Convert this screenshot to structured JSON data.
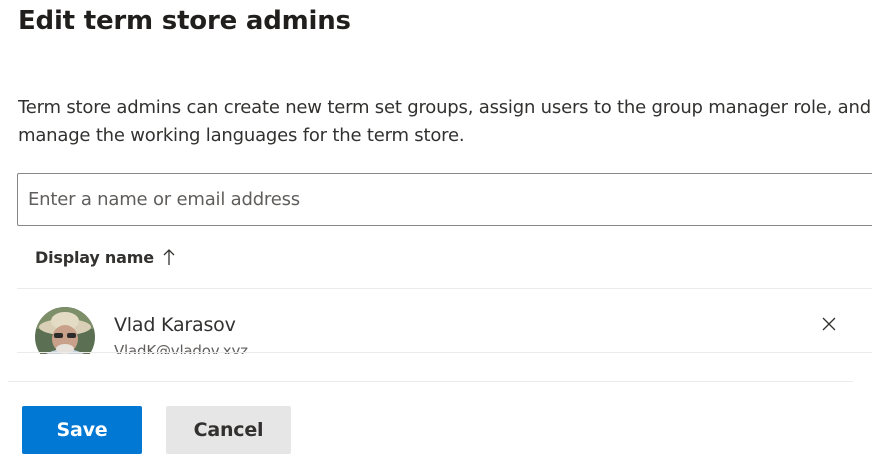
{
  "panel": {
    "title": "Edit term store admins",
    "description": "Term store admins can create new term set groups, assign users to the group manager role, and manage the working languages for the term store."
  },
  "picker": {
    "placeholder": "Enter a name or email address"
  },
  "list": {
    "column_header": "Display name",
    "sort_icon": "arrow-up-icon",
    "rows": [
      {
        "name": "Vlad Karasov",
        "email": "VladK@vladov.xyz",
        "avatar_icon": "user-photo",
        "remove_icon": "close-icon"
      }
    ]
  },
  "footer": {
    "save_label": "Save",
    "cancel_label": "Cancel"
  },
  "colors": {
    "primary": "#0078d4",
    "secondary_button": "#e6e6e6",
    "divider": "#edebe9"
  }
}
